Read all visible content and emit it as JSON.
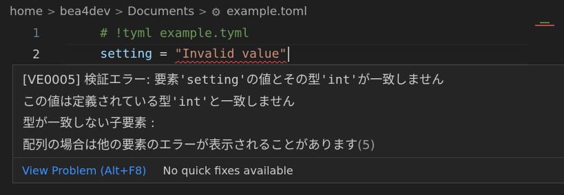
{
  "breadcrumb": {
    "items": [
      "home",
      "bea4dev",
      "Documents"
    ],
    "separator": ">",
    "file_icon": "gear-icon",
    "file": "example.toml"
  },
  "editor": {
    "lines": [
      {
        "number": "1",
        "comment": "# !tyml example.tyml"
      },
      {
        "number": "2",
        "key": "setting",
        "op": " = ",
        "value": "\"Invalid value\""
      }
    ]
  },
  "hover": {
    "line1": {
      "prefix": "[VE0005] 検証エラー: 要素",
      "key": "'setting'",
      "mid": "の値とその型",
      "type": "'int'",
      "suffix": "が一致しません"
    },
    "line2": {
      "prefix": "この値は定義されている型",
      "type": "'int'",
      "suffix": "と一致しません"
    },
    "line3": "型が一致しない子要素 :",
    "line4": {
      "text": "配列の場合は他の要素のエラーが表示されることがあります",
      "count": "(5)"
    },
    "view_problem": "View Problem (Alt+F8)",
    "no_fixes": "No quick fixes available"
  },
  "colors": {
    "background": "#1f1f1f",
    "comment": "#6a9955",
    "key": "#9cdcfe",
    "string": "#ce9178",
    "error": "#f14c4c",
    "link": "#3794ff"
  }
}
